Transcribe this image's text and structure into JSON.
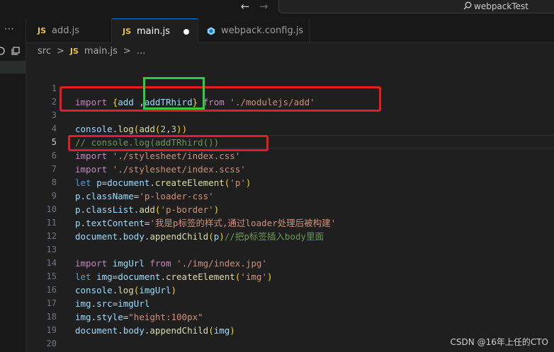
{
  "titlebar": {
    "back_icon": "arrow-left",
    "forward_icon": "arrow-right",
    "search_label": "webpackTest"
  },
  "sidebar": {
    "more": "···"
  },
  "tabs": [
    {
      "label": "add.js",
      "icon": "JS",
      "active": false
    },
    {
      "label": "main.js",
      "icon": "JS",
      "active": true,
      "dirty": true
    },
    {
      "label": "webpack.config.js",
      "icon": "webpack-icon",
      "active": false
    }
  ],
  "breadcrumb": {
    "folder": "src",
    "sep": ">",
    "file_icon": "JS",
    "file": "main.js",
    "sep2": ">",
    "more": "..."
  },
  "editor": {
    "current_line": 5,
    "lines": [
      {
        "n": 1,
        "text": ""
      },
      {
        "n": 2,
        "text": "import {add ,addTRhird} from './modulejs/add'"
      },
      {
        "n": 3,
        "text": ""
      },
      {
        "n": 4,
        "text": "console.log(add(2,3))"
      },
      {
        "n": 5,
        "text": "// console.log(addTRhird())"
      },
      {
        "n": 6,
        "text": "import './stylesheet/index.css'"
      },
      {
        "n": 7,
        "text": "import './stylesheet/index.scss'"
      },
      {
        "n": 8,
        "text": "let p=document.createElement('p')"
      },
      {
        "n": 9,
        "text": "p.className='p-loader-css'"
      },
      {
        "n": 10,
        "text": "p.classList.add('p-border')"
      },
      {
        "n": 11,
        "text": "p.textContent='我是p标签的样式,通过loader处理后被构建'"
      },
      {
        "n": 12,
        "text": "document.body.appendChild(p)//把p标签插入body里面"
      },
      {
        "n": 13,
        "text": ""
      },
      {
        "n": 14,
        "text": "import imgUrl from './img/index.jpg'"
      },
      {
        "n": 15,
        "text": "let img=document.createElement('img')"
      },
      {
        "n": 16,
        "text": "console.log(imgUrl)"
      },
      {
        "n": 17,
        "text": "img.src=imgUrl"
      },
      {
        "n": 18,
        "text": "img.style=\"height:100px\""
      },
      {
        "n": 19,
        "text": "document.body.appendChild(img)"
      },
      {
        "n": 20,
        "text": ""
      }
    ]
  },
  "watermark": "CSDN @16年上任的CTO",
  "colors": {
    "annotation_red": "#e51c23",
    "annotation_green": "#2ecc40",
    "accent": "#0078d4"
  }
}
